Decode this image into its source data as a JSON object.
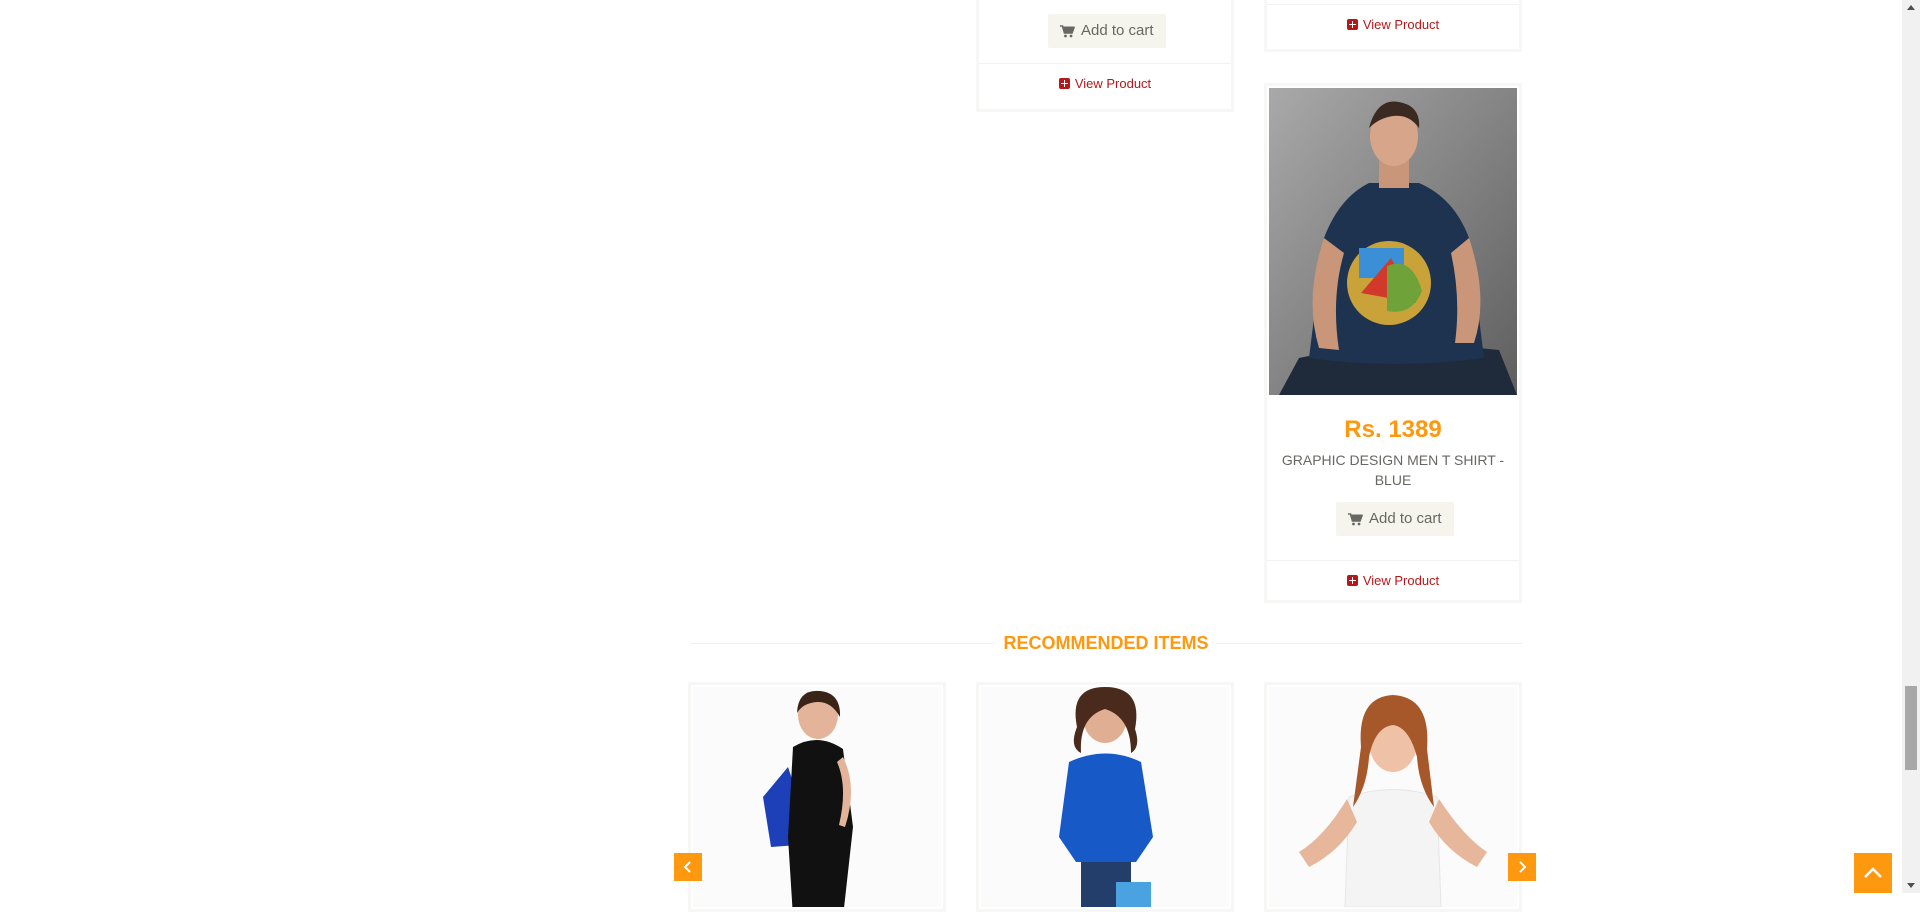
{
  "products": [
    {
      "id": "p1",
      "add_to_cart": "Add to cart",
      "view_product": "View Product"
    },
    {
      "id": "p2",
      "view_product": "View Product"
    },
    {
      "id": "p3",
      "price": "Rs. 1389",
      "name": "GRAPHIC DESIGN MEN T SHIRT - BLUE",
      "add_to_cart": "Add to cart",
      "view_product": "View Product"
    }
  ],
  "recommended": {
    "title": "RECOMMENDED ITEMS",
    "prev_icon": "chevron-left-icon",
    "next_icon": "chevron-right-icon"
  },
  "icons": {
    "cart": "cart-icon",
    "plus": "plus-square-icon",
    "scroll_top": "chevron-up-icon"
  },
  "colors": {
    "accent": "#FE980F",
    "link": "#B3191B",
    "button_bg": "#F5F5ED"
  }
}
